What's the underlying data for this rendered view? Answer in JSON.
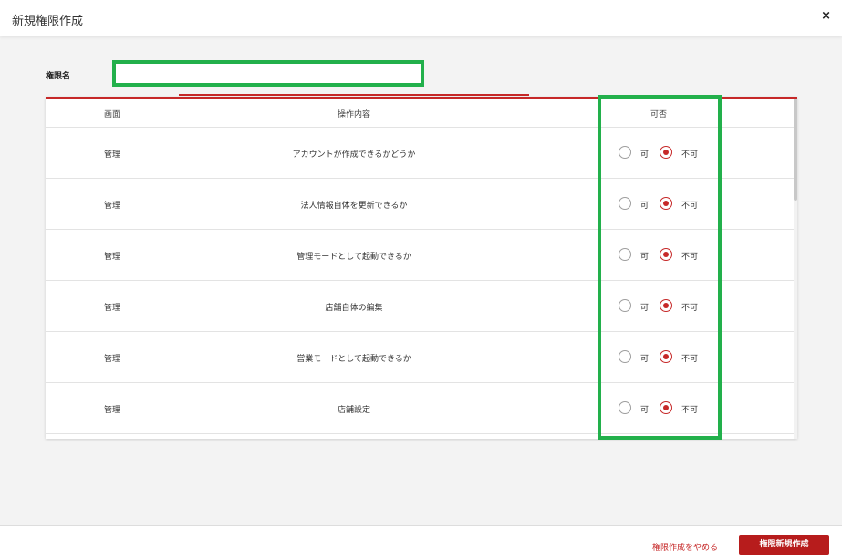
{
  "header": {
    "title": "新規権限作成",
    "close": "×"
  },
  "form": {
    "name_label": "権限名",
    "name_value": ""
  },
  "table": {
    "columns": {
      "screen": "画面",
      "operation": "操作内容",
      "permission": "可否"
    },
    "radio_labels": {
      "allow": "可",
      "deny": "不可"
    },
    "rows": [
      {
        "screen": "管理",
        "operation": "アカウントが作成できるかどうか",
        "selected": "deny"
      },
      {
        "screen": "管理",
        "operation": "法人情報自体を更新できるか",
        "selected": "deny"
      },
      {
        "screen": "管理",
        "operation": "管理モードとして起動できるか",
        "selected": "deny"
      },
      {
        "screen": "管理",
        "operation": "店舗自体の編集",
        "selected": "deny"
      },
      {
        "screen": "管理",
        "operation": "営業モードとして起動できるか",
        "selected": "deny"
      },
      {
        "screen": "管理",
        "operation": "店舗設定",
        "selected": "deny"
      }
    ]
  },
  "footer": {
    "cancel_label": "権限作成をやめる",
    "create_label": "権限新規作成"
  },
  "colors": {
    "accent": "#c62828",
    "highlight": "#22b04b"
  }
}
